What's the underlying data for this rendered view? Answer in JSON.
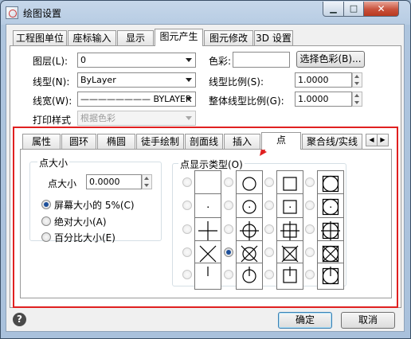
{
  "window": {
    "title": "绘图设置",
    "minimize": "▁",
    "maximize": "□",
    "close": "✕"
  },
  "tabs": [
    "工程图单位",
    "座标输入",
    "显示",
    "图元产生",
    "图元修改",
    "3D 设置"
  ],
  "props": {
    "layer_label": "图层(L):",
    "layer_value": "0",
    "linetype_label": "线型(N):",
    "linetype_value": "ByLayer",
    "lineweight_label": "线宽(W):",
    "lineweight_value": "———————— BYLAYER",
    "plotstyle_label": "打印样式",
    "plotstyle_value": "根据色彩",
    "color_label": "色彩:",
    "color_value": "",
    "color_button": "选择色彩(B)...",
    "ltscale_label": "线型比例(S):",
    "ltscale_value": "1.0000",
    "global_ltscale_label": "整体线型比例(G):",
    "global_ltscale_value": "1.0000"
  },
  "subtabs": [
    "属性",
    "圆环",
    "椭圆",
    "徒手绘制",
    "剖面线",
    "插入",
    "点",
    "聚合线/实线"
  ],
  "point": {
    "size_group": "点大小",
    "size_label": "点大小",
    "size_value": "0.0000",
    "opt1": "屏幕大小的 5%(C)",
    "opt2": "绝对大小(A)",
    "opt3": "百分比大小(E)",
    "type_group": "点显示类型(O)"
  },
  "buttons": {
    "ok": "确定",
    "cancel": "取消",
    "help": "?"
  },
  "colors": {
    "annotation": "#e02020",
    "accent": "#1d4f9a"
  }
}
